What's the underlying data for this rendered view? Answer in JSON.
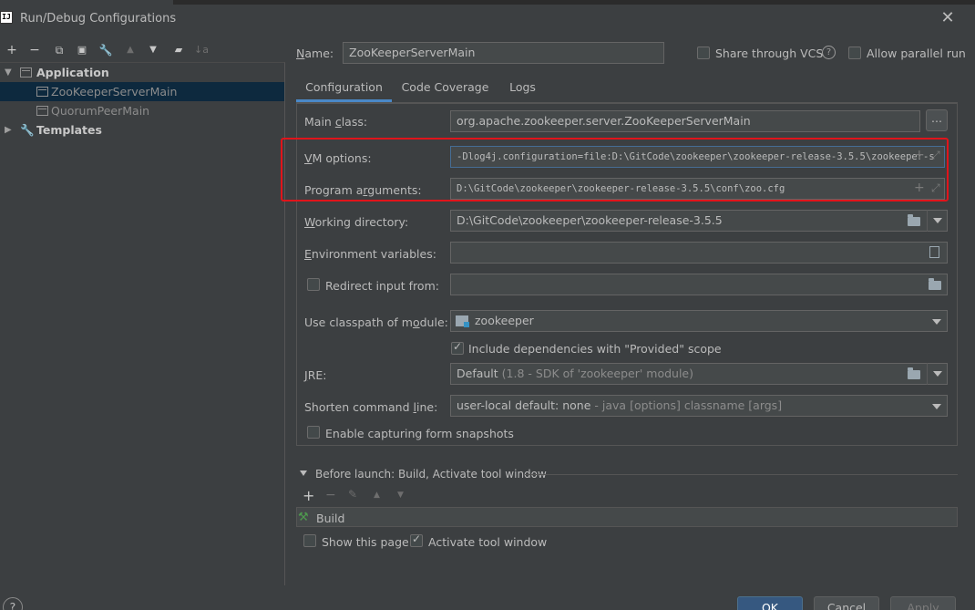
{
  "window": {
    "title": "Run/Debug Configurations",
    "app_icon": "IJ"
  },
  "toolbar": {
    "add": "+",
    "remove": "−",
    "copy": "⧉",
    "save": "💾",
    "edit": "🔧",
    "up": "▲",
    "down": "▼",
    "folder": "📁",
    "sort": "↓a"
  },
  "tree": {
    "application": "Application",
    "items": [
      "ZooKeeperServerMain",
      "QuorumPeerMain"
    ],
    "templates": "Templates"
  },
  "name": {
    "label": "Name:",
    "value": "ZooKeeperServerMain"
  },
  "share_vcs": {
    "label": "Share through VCS",
    "help": "?"
  },
  "allow_parallel": {
    "label": "Allow parallel run"
  },
  "tabs": [
    "Configuration",
    "Code Coverage",
    "Logs"
  ],
  "main_class": {
    "label": "Main class:",
    "value": "org.apache.zookeeper.server.ZooKeeperServerMain",
    "browse": "..."
  },
  "vm_options": {
    "label": "VM options:",
    "value": "-Dlog4j.configuration=file:D:\\GitCode\\zookeeper\\zookeeper-release-3.5.5\\zookeeper-s"
  },
  "program_args": {
    "label": "Program arguments:",
    "value": "D:\\GitCode\\zookeeper\\zookeeper-release-3.5.5\\conf\\zoo.cfg"
  },
  "working_dir": {
    "label": "Working directory:",
    "value": "D:\\GitCode\\zookeeper\\zookeeper-release-3.5.5"
  },
  "env_vars": {
    "label": "Environment variables:",
    "value": ""
  },
  "redirect": {
    "label": "Redirect input from:",
    "value": ""
  },
  "classpath": {
    "label": "Use classpath of module:",
    "value": "zookeeper"
  },
  "include_deps": {
    "label": "Include dependencies with \"Provided\" scope"
  },
  "jre": {
    "label": "JRE:",
    "value": "Default",
    "hint": "(1.8 - SDK of 'zookeeper' module)"
  },
  "shorten": {
    "label": "Shorten command line:",
    "value": "user-local default: none",
    "hint": "- java [options] classname [args]"
  },
  "snapshots": {
    "label": "Enable capturing form snapshots"
  },
  "before_launch": {
    "label": "Before launch: Build, Activate tool window",
    "item": "Build"
  },
  "show_page": {
    "label": "Show this page"
  },
  "activate_tool": {
    "label": "Activate tool window"
  },
  "buttons": {
    "ok": "OK",
    "cancel": "Cancel",
    "apply": "Apply",
    "help": "?"
  },
  "colors": {
    "background": "#3c3f41",
    "field": "#45494a",
    "selection": "#0d293e",
    "accent": "#4a88c7",
    "highlight": "#e0141b"
  }
}
